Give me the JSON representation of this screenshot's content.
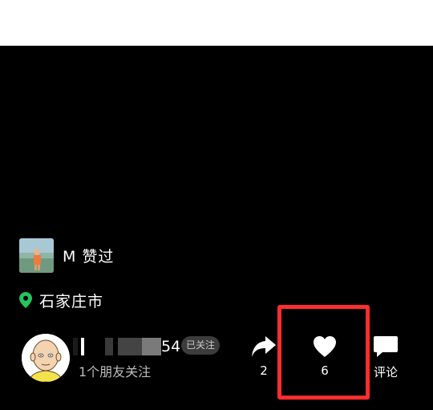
{
  "liked_by": {
    "text": "M 赞过"
  },
  "location": {
    "text": "石家庄市",
    "pin_color": "#22c55e"
  },
  "author": {
    "name_visible_suffix": "54",
    "follow_badge": "已关注",
    "friends_text": "1个朋友关注"
  },
  "actions": {
    "share_count": "2",
    "like_count": "6",
    "comment_label": "评论"
  },
  "highlight_color": "#ff2d2d"
}
